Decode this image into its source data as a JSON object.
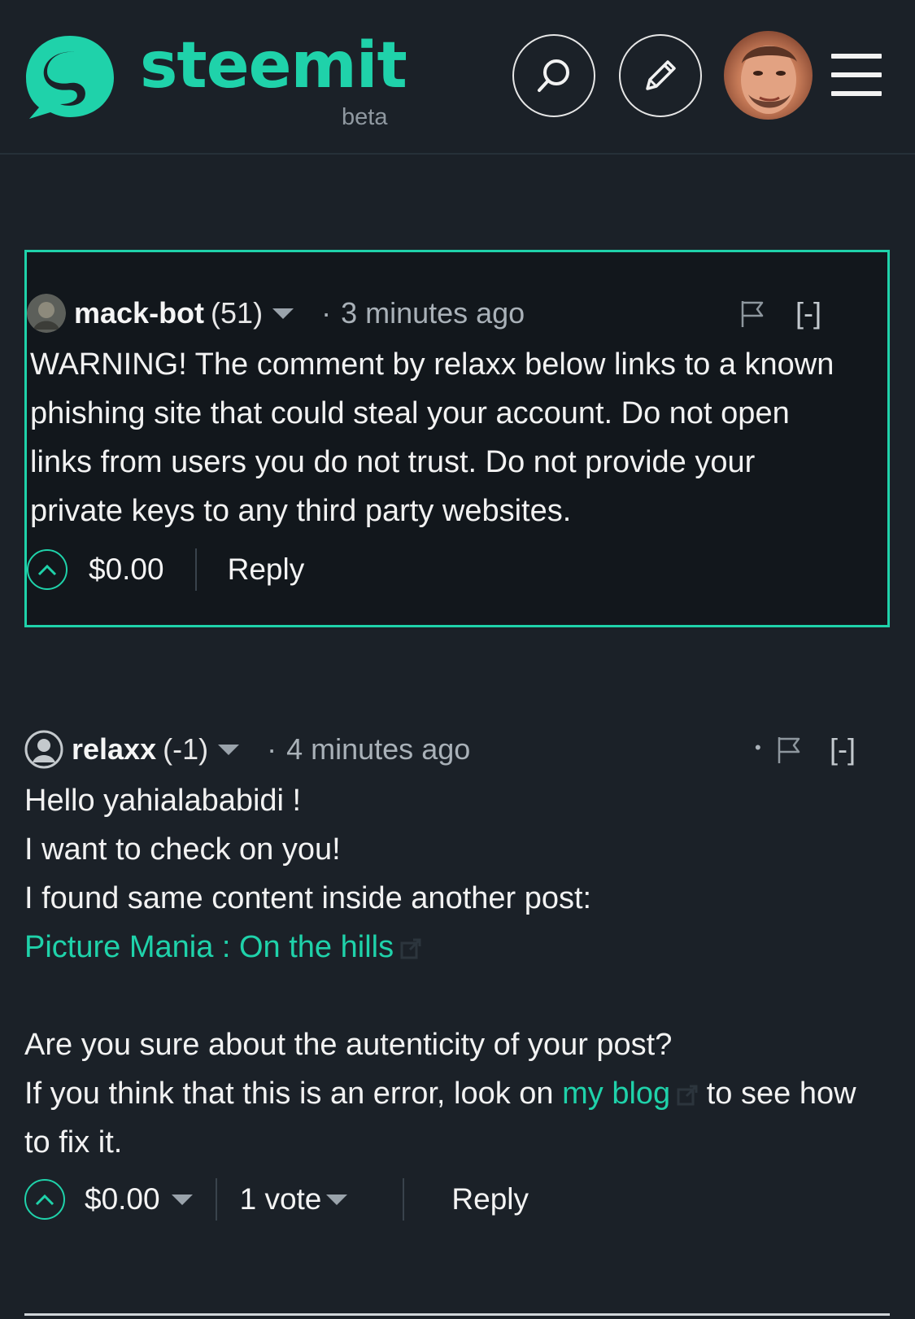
{
  "header": {
    "logo_text": "steemit",
    "logo_badge": "beta",
    "search_icon": "search-icon",
    "compose_icon": "pencil-icon",
    "menu_icon": "hamburger-menu-icon",
    "brand_color": "#1fd2aa"
  },
  "comments": [
    {
      "highlighted": true,
      "author": "mack-bot",
      "reputation": "(51)",
      "separator": "·",
      "time": "3 minutes ago",
      "collapse": "[-]",
      "body": [
        "WARNING! The comment by relaxx below links to a known",
        "phishing site that could steal your account. Do not open",
        "links from users you do not trust. Do not provide your",
        "private keys to any third party websites."
      ],
      "payout": "$0.00",
      "reply_label": "Reply"
    },
    {
      "highlighted": false,
      "author": "relaxx",
      "reputation": "(-1)",
      "separator": "·",
      "extra_dot": "•",
      "time": "4 minutes ago",
      "collapse": "[-]",
      "body_lines": {
        "line1": "Hello yahialababidi !",
        "line2": "I want to check on you!",
        "line3": "I found same content inside another post:",
        "link1": "Picture Mania : On the hills",
        "line5": "Are you sure about the autenticity of your post?",
        "line6_before": "If you think that this is an error, look on ",
        "link2": "my blog",
        "line6_after": " to see how",
        "line7": "to fix it."
      },
      "payout": "$0.00",
      "votes": "1 vote",
      "reply_label": "Reply"
    }
  ]
}
